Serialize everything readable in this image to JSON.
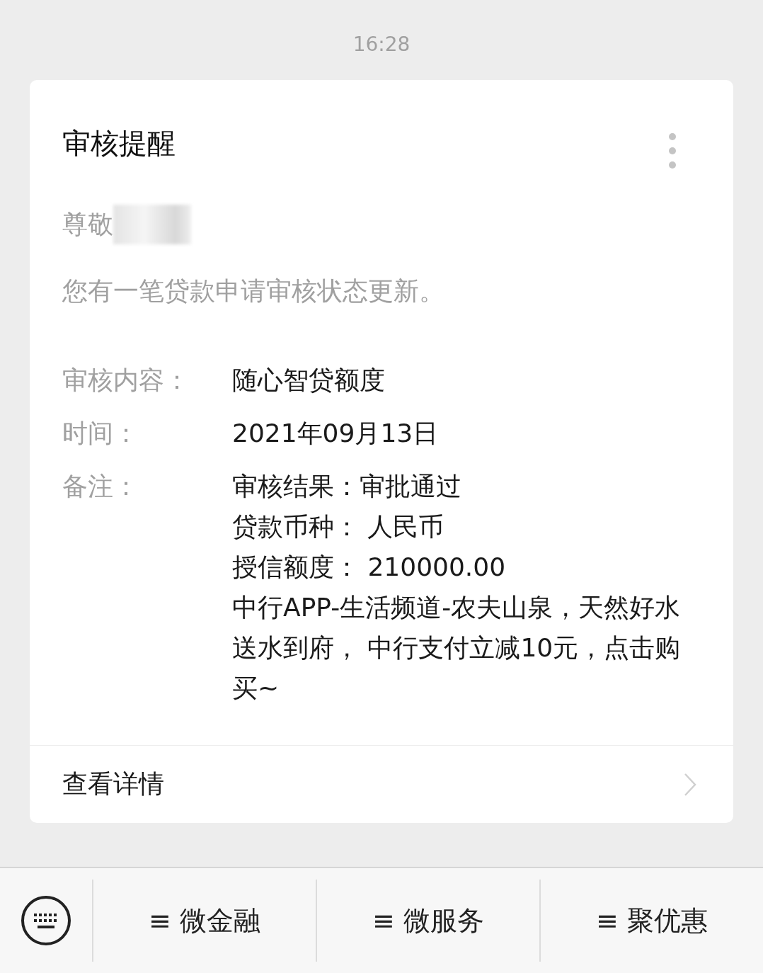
{
  "time": "16:28",
  "card": {
    "title": "审核提醒",
    "greeting": "尊敬",
    "message": "您有一笔贷款申请审核状态更新。",
    "fields": [
      {
        "label": "审核内容：",
        "lines": [
          "随心智贷额度"
        ]
      },
      {
        "label": "时间：",
        "lines": [
          "2021年09月13日"
        ]
      },
      {
        "label": "备注：",
        "lines": [
          "审核结果：审批通过",
          "贷款币种： 人民币",
          "授信额度： 210000.00",
          "中行APP-生活频道-农夫山泉，天然好水送水到府， 中行支付立减10元，点击购买~"
        ]
      }
    ],
    "link": "查看详情"
  },
  "menu": [
    {
      "label": "≡ 微金融"
    },
    {
      "label": "≡ 微服务"
    },
    {
      "label": "≡ 聚优惠"
    }
  ]
}
